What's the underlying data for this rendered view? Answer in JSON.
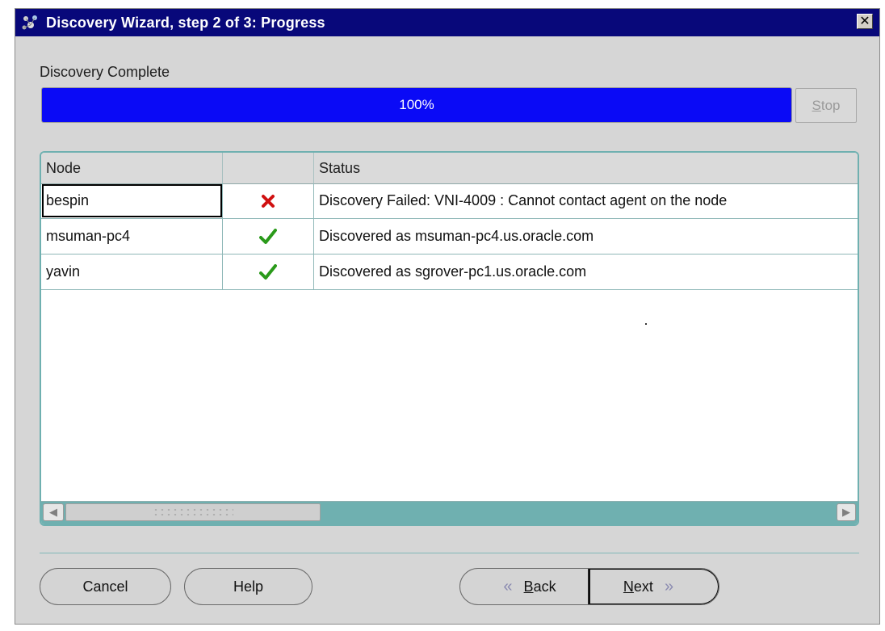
{
  "window": {
    "title": "Discovery Wizard, step 2 of 3: Progress",
    "close_glyph": "✕"
  },
  "progress": {
    "label": "Discovery Complete",
    "percent": 100,
    "percent_text": "100%",
    "stop_label": "Stop"
  },
  "table": {
    "columns": [
      "Node",
      "",
      "Status"
    ],
    "rows": [
      {
        "node": "bespin",
        "icon": "error-x-icon",
        "status": "Discovery Failed: VNI-4009 : Cannot contact agent on the node"
      },
      {
        "node": "msuman-pc4",
        "icon": "checkmark-icon",
        "status": "Discovered as msuman-pc4.us.oracle.com"
      },
      {
        "node": "yavin",
        "icon": "checkmark-icon",
        "status": "Discovered as sgrover-pc1.us.oracle.com"
      }
    ]
  },
  "buttons": {
    "cancel": "Cancel",
    "help": "Help",
    "back": "Back",
    "next": "Next"
  },
  "colors": {
    "title_bar": "#08087a",
    "progress_fill": "#0a0af6",
    "accent_teal": "#6fb0b0",
    "error_red": "#d01010",
    "success_green": "#2a9a1a"
  }
}
